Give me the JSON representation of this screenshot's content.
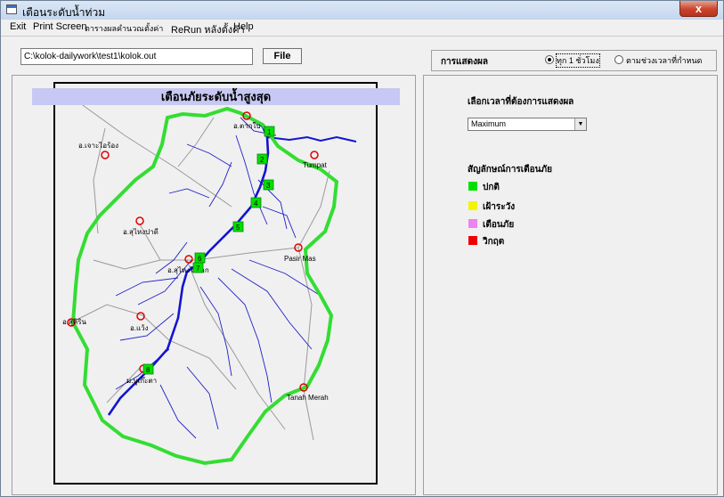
{
  "window": {
    "title": "เตือนระดับน้ำท่วม",
    "close_label": "x"
  },
  "menu": [
    "Exit",
    "Print Screen",
    "ตารางผลคำนวณ",
    "ตั้งค่า",
    "ReRun หลังตั้งค่า",
    "Help"
  ],
  "file": {
    "path_value": "C:\\kolok-dailywork\\test1\\kolok.out",
    "button_label": "File"
  },
  "display": {
    "label": "การแสดงผล",
    "options": [
      "ทุก 1 ชั่วโมง",
      "ตามช่วงเวลาที่กำหนด"
    ],
    "selected": "ทุก 1 ชั่วโมง"
  },
  "map": {
    "banner": "เตือนภัยระดับน้ำสูงสุด",
    "places": [
      "อ.ตากใบ",
      "อ.เจาะไอร้อง",
      "Tumpat",
      "อ.สุไหงปาดี",
      "Pasir Mas",
      "อ.สุไหงโก-ลก",
      "อ.สุคิริน",
      "อ.แว้ง",
      "ม.บูเก๊ะตา",
      "Tanah Merah"
    ],
    "stations": [
      {
        "id": "1",
        "status": "ปกติ"
      },
      {
        "id": "2",
        "status": "ปกติ"
      },
      {
        "id": "3",
        "status": "ปกติ"
      },
      {
        "id": "4",
        "status": "ปกติ"
      },
      {
        "id": "5",
        "status": "ปกติ"
      },
      {
        "id": "6",
        "status": "ปกติ"
      },
      {
        "id": "7",
        "status": "ปกติ"
      },
      {
        "id": "8",
        "status": "ปกติ"
      }
    ]
  },
  "side": {
    "select_label": "เลือกเวลาที่ต้องการแสดงผล",
    "select_value": "Maximum",
    "legend_title": "สัญลักษณ์การเตือนภัย",
    "legend": [
      {
        "label": "ปกติ",
        "color": "#00e000"
      },
      {
        "label": "เฝ้าระวัง",
        "color": "#f4f400"
      },
      {
        "label": "เตือนภัย",
        "color": "#ee82ee"
      },
      {
        "label": "วิกฤต",
        "color": "#ee0000"
      }
    ]
  }
}
